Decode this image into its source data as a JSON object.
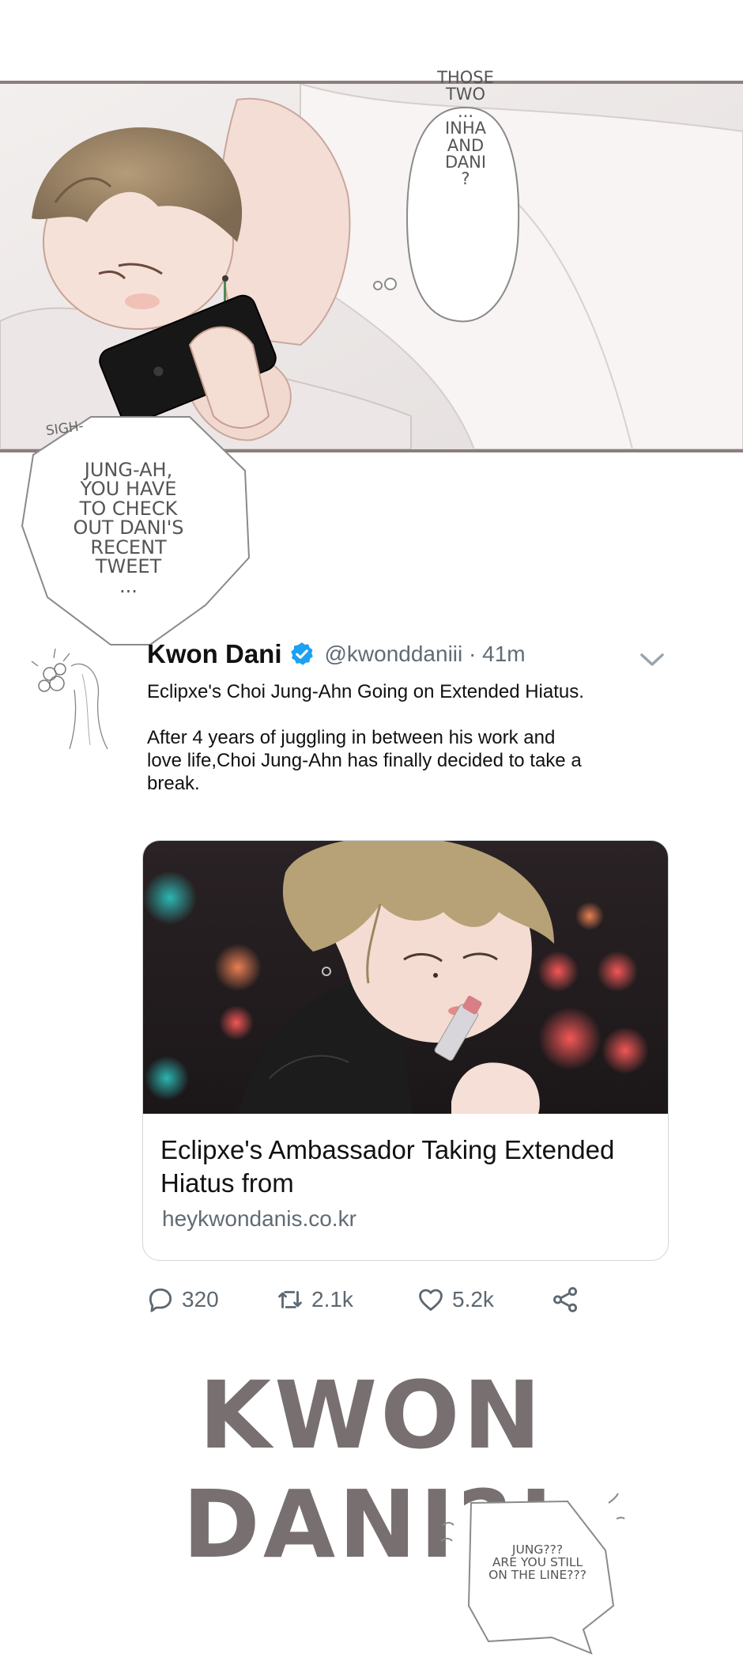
{
  "panel": {
    "thought_bubble": [
      "THOSE",
      "TWO",
      "...",
      "INHA",
      "AND",
      "DANI",
      "?"
    ],
    "sigh_text": "SIGH-",
    "speech_bubble": [
      "JUNG-AH,",
      "YOU HAVE",
      "TO CHECK",
      "OUT DANI'S",
      "RECENT",
      "TWEET",
      "..."
    ]
  },
  "tweet": {
    "name": "Kwon Dani",
    "handle_time": "@kwonddaniii · 41m",
    "icons": [
      "verified-badge-icon",
      "chevron-down-icon",
      "reply-icon",
      "retweet-icon",
      "like-icon",
      "share-icon"
    ],
    "body": [
      "Eclipxe's Choi Jung-Ahn Going on Extended Hiatus.",
      "After 4 years of juggling in between his work and love life,Choi Jung-Ahn has finally decided to take a break."
    ],
    "card": {
      "title": "Eclipxe's Ambassador Taking Extended Hiatus from",
      "domain": "heykwondanis.co.kr"
    },
    "actions": {
      "replies": "320",
      "retweets": "2.1k",
      "likes": "5.2k"
    },
    "colors": {
      "verified": "#1da1f2",
      "muted": "#606b75"
    }
  },
  "shout": "KWON DANI?!",
  "phone_bubble": [
    "JUNG???",
    "ARE YOU STILL",
    "ON THE LINE???"
  ]
}
